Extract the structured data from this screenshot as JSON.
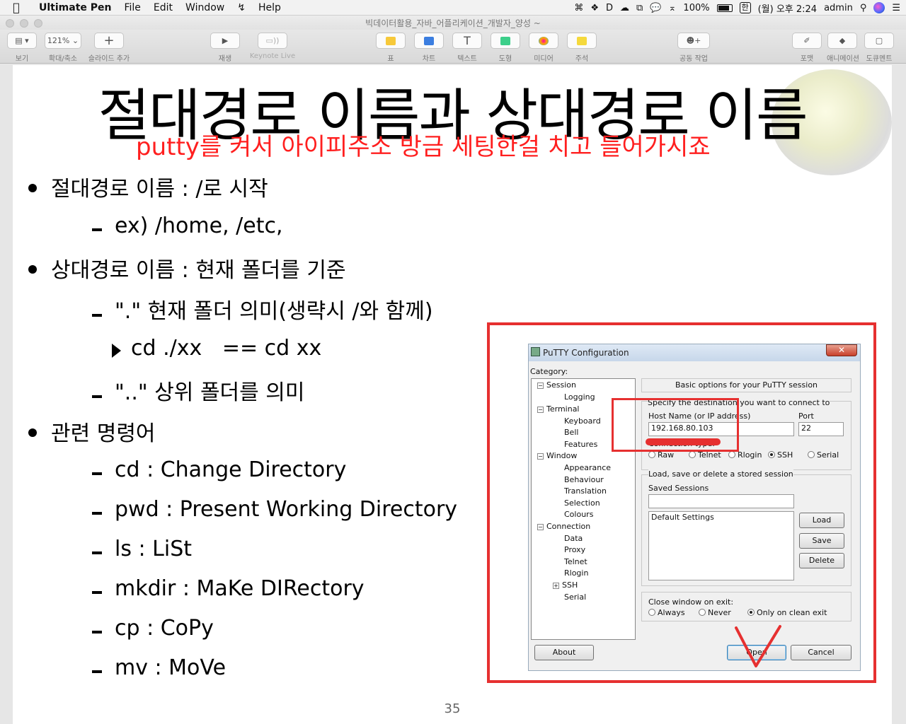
{
  "menubar": {
    "app_name": "Ultimate Pen",
    "items": [
      "File",
      "Edit",
      "Window",
      "Help"
    ],
    "battery": "100%",
    "input_source": "한",
    "clock": "(월) 오후 2:24",
    "user": "admin"
  },
  "window": {
    "title": "빅데이터활용_자바_어플리케이션_개발자_양성 ~"
  },
  "toolbar": {
    "view_label": "보기",
    "zoom_value": "121%",
    "zoom_label": "확대/축소",
    "add_slide_label": "슬라이드 추가",
    "play_label": "재생",
    "keynote_live_label": "Keynote Live",
    "table_label": "표",
    "chart_label": "차트",
    "text_label": "텍스트",
    "shape_label": "도형",
    "media_label": "미디어",
    "comment_label": "주석",
    "collaborate_label": "공동 작업",
    "format_label": "포맷",
    "animate_label": "애니메이션",
    "document_label": "도큐멘트",
    "text_icon_char": "T",
    "plus_char": "+"
  },
  "slide": {
    "title": "절대경로 이름과 상대경로 이름",
    "annotation": "putty를 켜서 아이피주소 방금 세팅한걸 치고 들어가시죠",
    "bullets": {
      "b1": "절대경로 이름 : /로 시작",
      "b1_sub": "ex) /home, /etc,",
      "b2": "상대경로 이름 : 현재 폴더를 기준",
      "b2_sub1": "\".\" 현재 폴더 의미(생략시 /와 함께)",
      "b2_sub1_sub": "cd ./xx   == cd xx",
      "b2_sub2": "\"..\" 상위 폴더를 의미",
      "b3": "관련 명령어",
      "cmds": [
        "cd : Change Directory",
        "pwd : Present Working Directory",
        "ls : LiSt",
        "mkdir : MaKe DIRectory",
        "cp : CoPy",
        "mv : MoVe"
      ]
    },
    "page_number": "35"
  },
  "putty": {
    "title": "PuTTY Configuration",
    "close_glyph": "✕",
    "category_label": "Category:",
    "tree": [
      "Session",
      "Logging",
      "Terminal",
      "Keyboard",
      "Bell",
      "Features",
      "Window",
      "Appearance",
      "Behaviour",
      "Translation",
      "Selection",
      "Colours",
      "Connection",
      "Data",
      "Proxy",
      "Telnet",
      "Rlogin",
      "SSH",
      "Serial"
    ],
    "expanded_glyph": "−",
    "collapsed_glyph": "+",
    "header": "Basic options for your PuTTY session",
    "dest_label": "Specify the destination you want to connect to",
    "host_label": "Host Name (or IP address)",
    "port_label": "Port",
    "host_value": "192.168.80.103",
    "port_value": "22",
    "conn_type_label": "Connection type:",
    "conn_types": [
      "Raw",
      "Telnet",
      "Rlogin",
      "SSH",
      "Serial"
    ],
    "selected_conn_type": "SSH",
    "sessions_group_label": "Load, save or delete a stored session",
    "saved_sessions_label": "Saved Sessions",
    "saved_sessions_value": "",
    "sessions_list": [
      "Default Settings"
    ],
    "load_label": "Load",
    "save_label": "Save",
    "delete_label": "Delete",
    "close_exit_label": "Close window on exit:",
    "close_exit_options": [
      "Always",
      "Never",
      "Only on clean exit"
    ],
    "selected_close_exit": "Only on clean exit",
    "about_label": "About",
    "open_label": "Open",
    "cancel_label": "Cancel"
  },
  "colors": {
    "annotation_red": "#e63030",
    "note_text_red": "#ff1f1f"
  }
}
